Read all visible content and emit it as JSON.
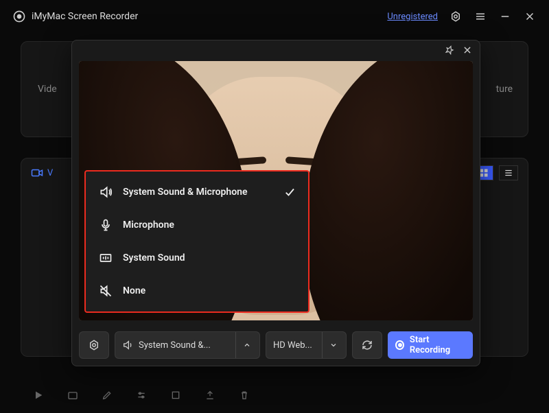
{
  "titlebar": {
    "app_name": "iMyMac Screen Recorder",
    "unregistered": "Unregistered"
  },
  "panels": {
    "left_label": "Vide",
    "right_label": "ture"
  },
  "list_header": {
    "label_prefix": "V"
  },
  "overlay": {
    "audio_menu": {
      "items": [
        {
          "label": "System Sound & Microphone",
          "icon": "speaker-icon",
          "selected": true
        },
        {
          "label": "Microphone",
          "icon": "microphone-icon",
          "selected": false
        },
        {
          "label": "System Sound",
          "icon": "system-sound-icon",
          "selected": false
        },
        {
          "label": "None",
          "icon": "mute-icon",
          "selected": false
        }
      ]
    },
    "toolbar": {
      "audio_dropdown": "System Sound &...",
      "camera_dropdown": "HD Web...",
      "start_label": "Start Recording"
    }
  }
}
